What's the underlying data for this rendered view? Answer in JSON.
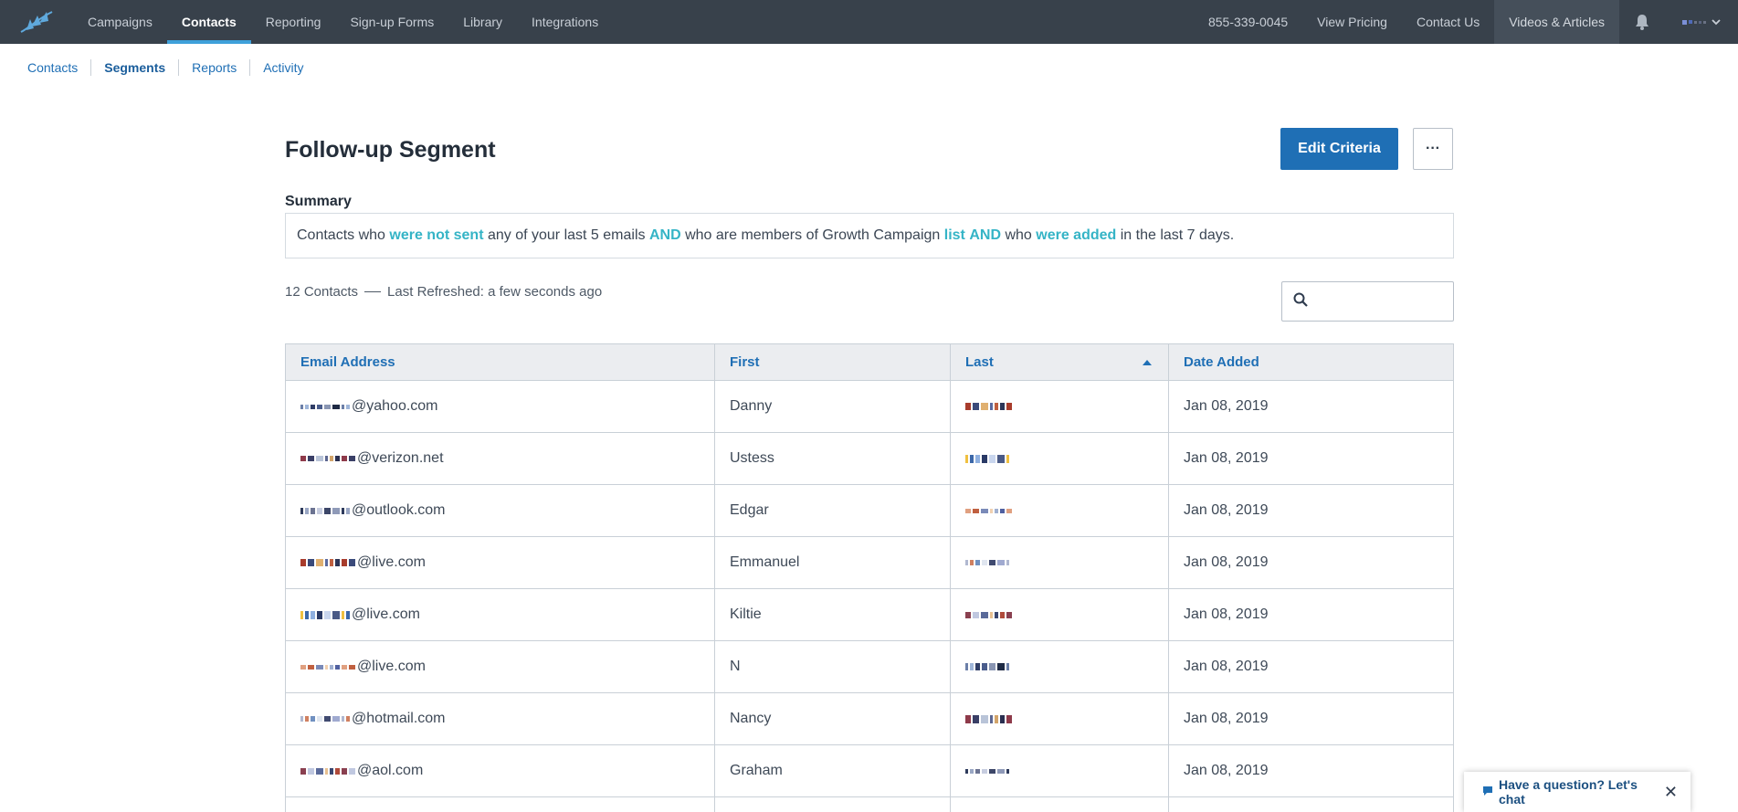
{
  "topnav": {
    "logo": "constant-contact-logo",
    "left_items": [
      {
        "label": "Campaigns",
        "active": false
      },
      {
        "label": "Contacts",
        "active": true
      },
      {
        "label": "Reporting",
        "active": false
      },
      {
        "label": "Sign-up Forms",
        "active": false
      },
      {
        "label": "Library",
        "active": false
      },
      {
        "label": "Integrations",
        "active": false
      }
    ],
    "phone": "855-339-0045",
    "view_pricing": "View Pricing",
    "contact_us": "Contact Us",
    "videos_articles": "Videos & Articles",
    "bell_icon": "bell-icon",
    "account_icon": "chevron-down-icon"
  },
  "subnav": {
    "items": [
      {
        "label": "Contacts",
        "active": false
      },
      {
        "label": "Segments",
        "active": true
      },
      {
        "label": "Reports",
        "active": false
      },
      {
        "label": "Activity",
        "active": false
      }
    ]
  },
  "page": {
    "title": "Follow-up Segment",
    "edit_button": "Edit Criteria",
    "more_button": "···",
    "summary_label": "Summary",
    "summary_parts": [
      {
        "text": "Contacts who ",
        "hl": false
      },
      {
        "text": "were not sent",
        "hl": true
      },
      {
        "text": " any of your last 5 emails ",
        "hl": false
      },
      {
        "text": "AND",
        "hl": true
      },
      {
        "text": " who are members of Growth Campaign ",
        "hl": false
      },
      {
        "text": "list",
        "hl": true
      },
      {
        "text": " ",
        "hl": false
      },
      {
        "text": "AND",
        "hl": true
      },
      {
        "text": " who ",
        "hl": false
      },
      {
        "text": "were added",
        "hl": true
      },
      {
        "text": " in the last 7 days.",
        "hl": false
      }
    ],
    "contacts_count": "12 Contacts",
    "last_refreshed": "Last Refreshed: a few seconds ago",
    "search_placeholder": ""
  },
  "table": {
    "columns": [
      "Email Address",
      "First",
      "Last",
      "Date Added"
    ],
    "sorted_column": "Last",
    "sort_direction": "ascending",
    "rows": [
      {
        "email_domain": "@yahoo.com",
        "first": "Danny",
        "date": "Jan 08, 2019"
      },
      {
        "email_domain": "@verizon.net",
        "first": "Ustess",
        "date": "Jan 08, 2019"
      },
      {
        "email_domain": "@outlook.com",
        "first": "Edgar",
        "date": "Jan 08, 2019"
      },
      {
        "email_domain": "@live.com",
        "first": "Emmanuel",
        "date": "Jan 08, 2019"
      },
      {
        "email_domain": "@live.com",
        "first": "Kiltie",
        "date": "Jan 08, 2019"
      },
      {
        "email_domain": "@live.com",
        "first": "N",
        "date": "Jan 08, 2019"
      },
      {
        "email_domain": "@hotmail.com",
        "first": "Nancy",
        "date": "Jan 08, 2019"
      },
      {
        "email_domain": "@aol.com",
        "first": "Graham",
        "date": "Jan 08, 2019"
      }
    ]
  },
  "chat": {
    "label": "Have a question? Let's chat",
    "close": "✕"
  },
  "colors": {
    "nav_bg": "#38414b",
    "accent": "#1f6fb5",
    "highlight": "#35b4c6",
    "active_underline": "#3ea0da"
  }
}
